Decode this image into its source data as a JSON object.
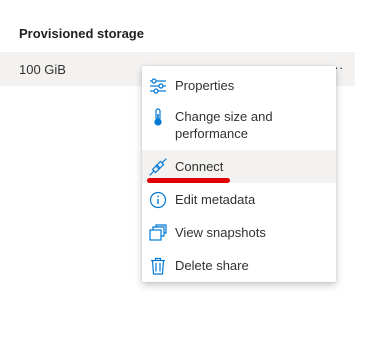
{
  "table": {
    "column_header": "Provisioned storage",
    "row_value": "100 GiB",
    "more_label": "..."
  },
  "menu": {
    "items": [
      {
        "label": "Properties",
        "icon": "properties-sliders-icon"
      },
      {
        "label": "Change size and performance",
        "icon": "thermometer-icon"
      },
      {
        "label": "Connect",
        "icon": "plug-connect-icon"
      },
      {
        "label": "Edit metadata",
        "icon": "info-icon"
      },
      {
        "label": "View snapshots",
        "icon": "snapshots-icon"
      },
      {
        "label": "Delete share",
        "icon": "trash-icon"
      }
    ]
  },
  "colors": {
    "accent": "#0078d4",
    "highlight_row": "#f3f2f1",
    "annotation_underline": "#e00000"
  }
}
